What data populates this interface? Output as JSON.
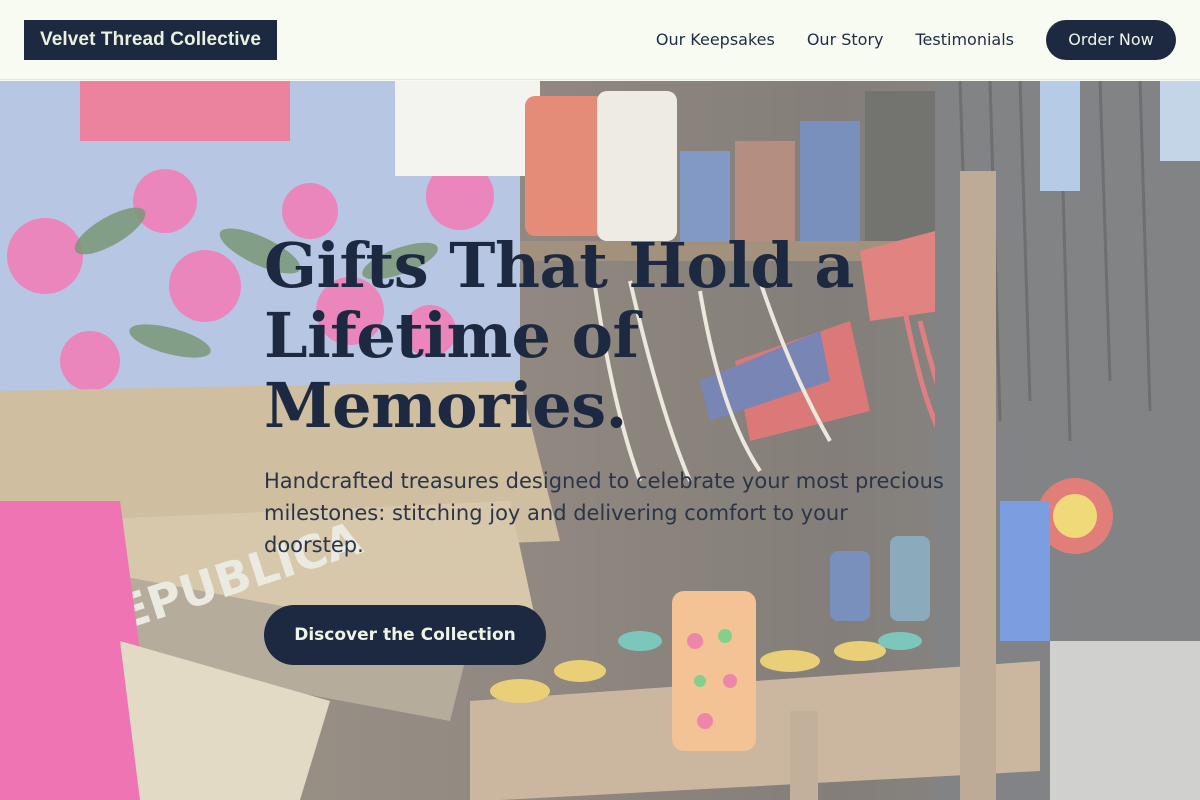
{
  "header": {
    "brand": "Velvet Thread Collective",
    "nav": [
      "Our Keepsakes",
      "Our Story",
      "Testimonials"
    ],
    "order_label": "Order Now"
  },
  "hero": {
    "title": "Gifts That Hold a Lifetime of Memories.",
    "subtitle": "Handcrafted treasures designed to celebrate your most precious milestones: stitching joy and delivering comfort to your doorstep.",
    "cta_label": "Discover the Collection",
    "image_subject": "souvenir market stall with fabrics, bottles, shell necklaces and flags",
    "banner_text": "REPUBLICA"
  },
  "colors": {
    "brand_navy": "#1c2940",
    "header_bg": "#f8fbf2",
    "veil": "rgba(248,250,244,0.38)"
  }
}
